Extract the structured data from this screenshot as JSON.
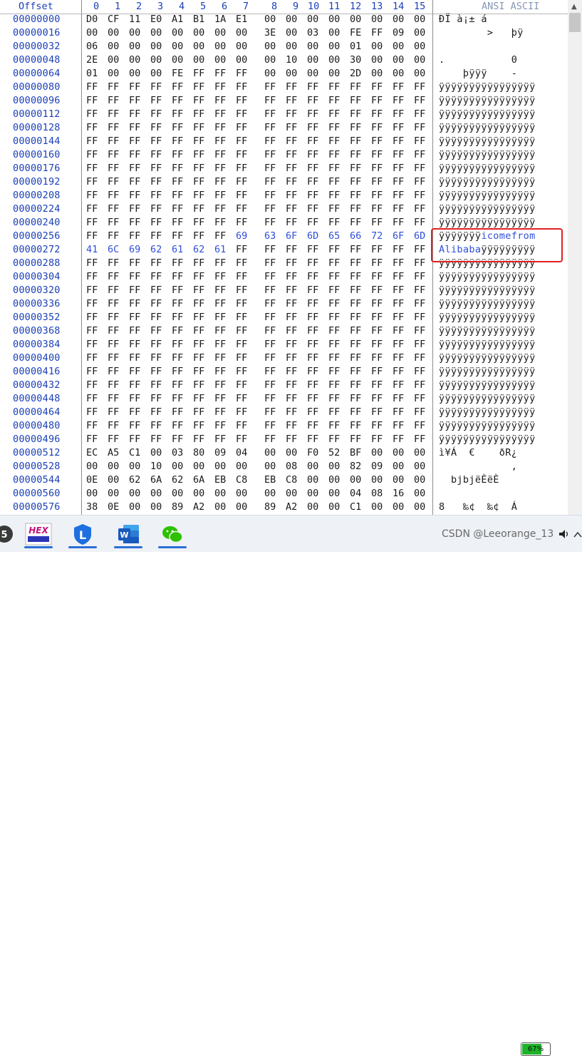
{
  "header": {
    "offset_label": "Offset",
    "columns": [
      "0",
      "1",
      "2",
      "3",
      "4",
      "5",
      "6",
      "7",
      "8",
      "9",
      "10",
      "11",
      "12",
      "13",
      "14",
      "15"
    ],
    "ascii_label": "ANSI ASCII"
  },
  "rows": [
    {
      "offset": "00000000",
      "bytes": [
        "D0",
        "CF",
        "11",
        "E0",
        "A1",
        "B1",
        "1A",
        "E1",
        "00",
        "00",
        "00",
        "00",
        "00",
        "00",
        "00",
        "00"
      ],
      "ascii": "ÐÏ à¡± á"
    },
    {
      "offset": "00000016",
      "bytes": [
        "00",
        "00",
        "00",
        "00",
        "00",
        "00",
        "00",
        "00",
        "3E",
        "00",
        "03",
        "00",
        "FE",
        "FF",
        "09",
        "00"
      ],
      "ascii": "        >   þÿ"
    },
    {
      "offset": "00000032",
      "bytes": [
        "06",
        "00",
        "00",
        "00",
        "00",
        "00",
        "00",
        "00",
        "00",
        "00",
        "00",
        "00",
        "01",
        "00",
        "00",
        "00"
      ],
      "ascii": ""
    },
    {
      "offset": "00000048",
      "bytes": [
        "2E",
        "00",
        "00",
        "00",
        "00",
        "00",
        "00",
        "00",
        "00",
        "10",
        "00",
        "00",
        "30",
        "00",
        "00",
        "00"
      ],
      "ascii": ".           0"
    },
    {
      "offset": "00000064",
      "bytes": [
        "01",
        "00",
        "00",
        "00",
        "FE",
        "FF",
        "FF",
        "FF",
        "00",
        "00",
        "00",
        "00",
        "2D",
        "00",
        "00",
        "00"
      ],
      "ascii": "    þÿÿÿ    -"
    },
    {
      "offset": "00000080",
      "bytes": [
        "FF",
        "FF",
        "FF",
        "FF",
        "FF",
        "FF",
        "FF",
        "FF",
        "FF",
        "FF",
        "FF",
        "FF",
        "FF",
        "FF",
        "FF",
        "FF"
      ],
      "ascii": "ÿÿÿÿÿÿÿÿÿÿÿÿÿÿÿÿ"
    },
    {
      "offset": "00000096",
      "bytes": [
        "FF",
        "FF",
        "FF",
        "FF",
        "FF",
        "FF",
        "FF",
        "FF",
        "FF",
        "FF",
        "FF",
        "FF",
        "FF",
        "FF",
        "FF",
        "FF"
      ],
      "ascii": "ÿÿÿÿÿÿÿÿÿÿÿÿÿÿÿÿ"
    },
    {
      "offset": "00000112",
      "bytes": [
        "FF",
        "FF",
        "FF",
        "FF",
        "FF",
        "FF",
        "FF",
        "FF",
        "FF",
        "FF",
        "FF",
        "FF",
        "FF",
        "FF",
        "FF",
        "FF"
      ],
      "ascii": "ÿÿÿÿÿÿÿÿÿÿÿÿÿÿÿÿ"
    },
    {
      "offset": "00000128",
      "bytes": [
        "FF",
        "FF",
        "FF",
        "FF",
        "FF",
        "FF",
        "FF",
        "FF",
        "FF",
        "FF",
        "FF",
        "FF",
        "FF",
        "FF",
        "FF",
        "FF"
      ],
      "ascii": "ÿÿÿÿÿÿÿÿÿÿÿÿÿÿÿÿ"
    },
    {
      "offset": "00000144",
      "bytes": [
        "FF",
        "FF",
        "FF",
        "FF",
        "FF",
        "FF",
        "FF",
        "FF",
        "FF",
        "FF",
        "FF",
        "FF",
        "FF",
        "FF",
        "FF",
        "FF"
      ],
      "ascii": "ÿÿÿÿÿÿÿÿÿÿÿÿÿÿÿÿ"
    },
    {
      "offset": "00000160",
      "bytes": [
        "FF",
        "FF",
        "FF",
        "FF",
        "FF",
        "FF",
        "FF",
        "FF",
        "FF",
        "FF",
        "FF",
        "FF",
        "FF",
        "FF",
        "FF",
        "FF"
      ],
      "ascii": "ÿÿÿÿÿÿÿÿÿÿÿÿÿÿÿÿ"
    },
    {
      "offset": "00000176",
      "bytes": [
        "FF",
        "FF",
        "FF",
        "FF",
        "FF",
        "FF",
        "FF",
        "FF",
        "FF",
        "FF",
        "FF",
        "FF",
        "FF",
        "FF",
        "FF",
        "FF"
      ],
      "ascii": "ÿÿÿÿÿÿÿÿÿÿÿÿÿÿÿÿ"
    },
    {
      "offset": "00000192",
      "bytes": [
        "FF",
        "FF",
        "FF",
        "FF",
        "FF",
        "FF",
        "FF",
        "FF",
        "FF",
        "FF",
        "FF",
        "FF",
        "FF",
        "FF",
        "FF",
        "FF"
      ],
      "ascii": "ÿÿÿÿÿÿÿÿÿÿÿÿÿÿÿÿ"
    },
    {
      "offset": "00000208",
      "bytes": [
        "FF",
        "FF",
        "FF",
        "FF",
        "FF",
        "FF",
        "FF",
        "FF",
        "FF",
        "FF",
        "FF",
        "FF",
        "FF",
        "FF",
        "FF",
        "FF"
      ],
      "ascii": "ÿÿÿÿÿÿÿÿÿÿÿÿÿÿÿÿ"
    },
    {
      "offset": "00000224",
      "bytes": [
        "FF",
        "FF",
        "FF",
        "FF",
        "FF",
        "FF",
        "FF",
        "FF",
        "FF",
        "FF",
        "FF",
        "FF",
        "FF",
        "FF",
        "FF",
        "FF"
      ],
      "ascii": "ÿÿÿÿÿÿÿÿÿÿÿÿÿÿÿÿ"
    },
    {
      "offset": "00000240",
      "bytes": [
        "FF",
        "FF",
        "FF",
        "FF",
        "FF",
        "FF",
        "FF",
        "FF",
        "FF",
        "FF",
        "FF",
        "FF",
        "FF",
        "FF",
        "FF",
        "FF"
      ],
      "ascii": "ÿÿÿÿÿÿÿÿÿÿÿÿÿÿÿÿ"
    },
    {
      "offset": "00000256",
      "bytes": [
        "FF",
        "FF",
        "FF",
        "FF",
        "FF",
        "FF",
        "FF",
        "69",
        "63",
        "6F",
        "6D",
        "65",
        "66",
        "72",
        "6F",
        "6D"
      ],
      "highlight_from": 7,
      "ascii_plain": "ÿÿÿÿÿÿÿ",
      "ascii_hl": "icomefrom"
    },
    {
      "offset": "00000272",
      "bytes": [
        "41",
        "6C",
        "69",
        "62",
        "61",
        "62",
        "61",
        "FF",
        "FF",
        "FF",
        "FF",
        "FF",
        "FF",
        "FF",
        "FF",
        "FF"
      ],
      "highlight_to": 7,
      "ascii_hl": "Alibaba",
      "ascii_plain_after": "ÿÿÿÿÿÿÿÿÿ"
    },
    {
      "offset": "00000288",
      "bytes": [
        "FF",
        "FF",
        "FF",
        "FF",
        "FF",
        "FF",
        "FF",
        "FF",
        "FF",
        "FF",
        "FF",
        "FF",
        "FF",
        "FF",
        "FF",
        "FF"
      ],
      "ascii": "ÿÿÿÿÿÿÿÿÿÿÿÿÿÿÿÿ"
    },
    {
      "offset": "00000304",
      "bytes": [
        "FF",
        "FF",
        "FF",
        "FF",
        "FF",
        "FF",
        "FF",
        "FF",
        "FF",
        "FF",
        "FF",
        "FF",
        "FF",
        "FF",
        "FF",
        "FF"
      ],
      "ascii": "ÿÿÿÿÿÿÿÿÿÿÿÿÿÿÿÿ"
    },
    {
      "offset": "00000320",
      "bytes": [
        "FF",
        "FF",
        "FF",
        "FF",
        "FF",
        "FF",
        "FF",
        "FF",
        "FF",
        "FF",
        "FF",
        "FF",
        "FF",
        "FF",
        "FF",
        "FF"
      ],
      "ascii": "ÿÿÿÿÿÿÿÿÿÿÿÿÿÿÿÿ"
    },
    {
      "offset": "00000336",
      "bytes": [
        "FF",
        "FF",
        "FF",
        "FF",
        "FF",
        "FF",
        "FF",
        "FF",
        "FF",
        "FF",
        "FF",
        "FF",
        "FF",
        "FF",
        "FF",
        "FF"
      ],
      "ascii": "ÿÿÿÿÿÿÿÿÿÿÿÿÿÿÿÿ"
    },
    {
      "offset": "00000352",
      "bytes": [
        "FF",
        "FF",
        "FF",
        "FF",
        "FF",
        "FF",
        "FF",
        "FF",
        "FF",
        "FF",
        "FF",
        "FF",
        "FF",
        "FF",
        "FF",
        "FF"
      ],
      "ascii": "ÿÿÿÿÿÿÿÿÿÿÿÿÿÿÿÿ"
    },
    {
      "offset": "00000368",
      "bytes": [
        "FF",
        "FF",
        "FF",
        "FF",
        "FF",
        "FF",
        "FF",
        "FF",
        "FF",
        "FF",
        "FF",
        "FF",
        "FF",
        "FF",
        "FF",
        "FF"
      ],
      "ascii": "ÿÿÿÿÿÿÿÿÿÿÿÿÿÿÿÿ"
    },
    {
      "offset": "00000384",
      "bytes": [
        "FF",
        "FF",
        "FF",
        "FF",
        "FF",
        "FF",
        "FF",
        "FF",
        "FF",
        "FF",
        "FF",
        "FF",
        "FF",
        "FF",
        "FF",
        "FF"
      ],
      "ascii": "ÿÿÿÿÿÿÿÿÿÿÿÿÿÿÿÿ"
    },
    {
      "offset": "00000400",
      "bytes": [
        "FF",
        "FF",
        "FF",
        "FF",
        "FF",
        "FF",
        "FF",
        "FF",
        "FF",
        "FF",
        "FF",
        "FF",
        "FF",
        "FF",
        "FF",
        "FF"
      ],
      "ascii": "ÿÿÿÿÿÿÿÿÿÿÿÿÿÿÿÿ"
    },
    {
      "offset": "00000416",
      "bytes": [
        "FF",
        "FF",
        "FF",
        "FF",
        "FF",
        "FF",
        "FF",
        "FF",
        "FF",
        "FF",
        "FF",
        "FF",
        "FF",
        "FF",
        "FF",
        "FF"
      ],
      "ascii": "ÿÿÿÿÿÿÿÿÿÿÿÿÿÿÿÿ"
    },
    {
      "offset": "00000432",
      "bytes": [
        "FF",
        "FF",
        "FF",
        "FF",
        "FF",
        "FF",
        "FF",
        "FF",
        "FF",
        "FF",
        "FF",
        "FF",
        "FF",
        "FF",
        "FF",
        "FF"
      ],
      "ascii": "ÿÿÿÿÿÿÿÿÿÿÿÿÿÿÿÿ"
    },
    {
      "offset": "00000448",
      "bytes": [
        "FF",
        "FF",
        "FF",
        "FF",
        "FF",
        "FF",
        "FF",
        "FF",
        "FF",
        "FF",
        "FF",
        "FF",
        "FF",
        "FF",
        "FF",
        "FF"
      ],
      "ascii": "ÿÿÿÿÿÿÿÿÿÿÿÿÿÿÿÿ"
    },
    {
      "offset": "00000464",
      "bytes": [
        "FF",
        "FF",
        "FF",
        "FF",
        "FF",
        "FF",
        "FF",
        "FF",
        "FF",
        "FF",
        "FF",
        "FF",
        "FF",
        "FF",
        "FF",
        "FF"
      ],
      "ascii": "ÿÿÿÿÿÿÿÿÿÿÿÿÿÿÿÿ"
    },
    {
      "offset": "00000480",
      "bytes": [
        "FF",
        "FF",
        "FF",
        "FF",
        "FF",
        "FF",
        "FF",
        "FF",
        "FF",
        "FF",
        "FF",
        "FF",
        "FF",
        "FF",
        "FF",
        "FF"
      ],
      "ascii": "ÿÿÿÿÿÿÿÿÿÿÿÿÿÿÿÿ"
    },
    {
      "offset": "00000496",
      "bytes": [
        "FF",
        "FF",
        "FF",
        "FF",
        "FF",
        "FF",
        "FF",
        "FF",
        "FF",
        "FF",
        "FF",
        "FF",
        "FF",
        "FF",
        "FF",
        "FF"
      ],
      "ascii": "ÿÿÿÿÿÿÿÿÿÿÿÿÿÿÿÿ"
    },
    {
      "offset": "00000512",
      "bytes": [
        "EC",
        "A5",
        "C1",
        "00",
        "03",
        "80",
        "09",
        "04",
        "00",
        "00",
        "F0",
        "52",
        "BF",
        "00",
        "00",
        "00"
      ],
      "ascii": "ì¥Á  €    ðR¿"
    },
    {
      "offset": "00000528",
      "bytes": [
        "00",
        "00",
        "00",
        "10",
        "00",
        "00",
        "00",
        "00",
        "00",
        "08",
        "00",
        "00",
        "82",
        "09",
        "00",
        "00"
      ],
      "ascii": "            ‚"
    },
    {
      "offset": "00000544",
      "bytes": [
        "0E",
        "00",
        "62",
        "6A",
        "62",
        "6A",
        "EB",
        "C8",
        "EB",
        "C8",
        "00",
        "00",
        "00",
        "00",
        "00",
        "00"
      ],
      "ascii": "  bjbjëÈëÈ"
    },
    {
      "offset": "00000560",
      "bytes": [
        "00",
        "00",
        "00",
        "00",
        "00",
        "00",
        "00",
        "00",
        "00",
        "00",
        "00",
        "00",
        "04",
        "08",
        "16",
        "00"
      ],
      "ascii": ""
    },
    {
      "offset": "00000576",
      "bytes": [
        "38",
        "0E",
        "00",
        "00",
        "89",
        "A2",
        "00",
        "00",
        "89",
        "A2",
        "00",
        "00",
        "C1",
        "00",
        "00",
        "00"
      ],
      "ascii": "8   ‰¢  ‰¢  Á"
    }
  ],
  "taskbar": {
    "items": [
      {
        "name": "app-5-icon",
        "label": "5"
      },
      {
        "name": "hex-editor-icon",
        "label": "HEX"
      },
      {
        "name": "browser-icon",
        "label": "L"
      },
      {
        "name": "word-icon",
        "label": "W"
      },
      {
        "name": "wechat-icon",
        "label": ""
      }
    ],
    "watermark": "CSDN @Leeorange_13",
    "battery_label": "67%",
    "battery_level": 0.67
  },
  "colors": {
    "offset": "#1a3fb8",
    "highlight": "#2f4fd8",
    "redbox": "#e02020",
    "battery": "#1fb32a"
  }
}
